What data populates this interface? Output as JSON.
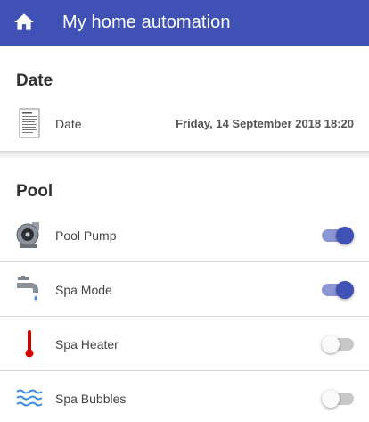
{
  "app": {
    "title": "My home automation",
    "accent": "#3f51b5"
  },
  "date_card": {
    "title": "Date",
    "row": {
      "label": "Date",
      "value": "Friday, 14 September 2018 18:20",
      "icon": "document-icon"
    }
  },
  "pool_card": {
    "title": "Pool",
    "rows": [
      {
        "label": "Pool Pump",
        "icon": "pump-icon",
        "on": true
      },
      {
        "label": "Spa Mode",
        "icon": "faucet-icon",
        "on": true
      },
      {
        "label": "Spa Heater",
        "icon": "thermometer-icon",
        "on": false
      },
      {
        "label": "Spa Bubbles",
        "icon": "waves-icon",
        "on": false
      }
    ]
  }
}
